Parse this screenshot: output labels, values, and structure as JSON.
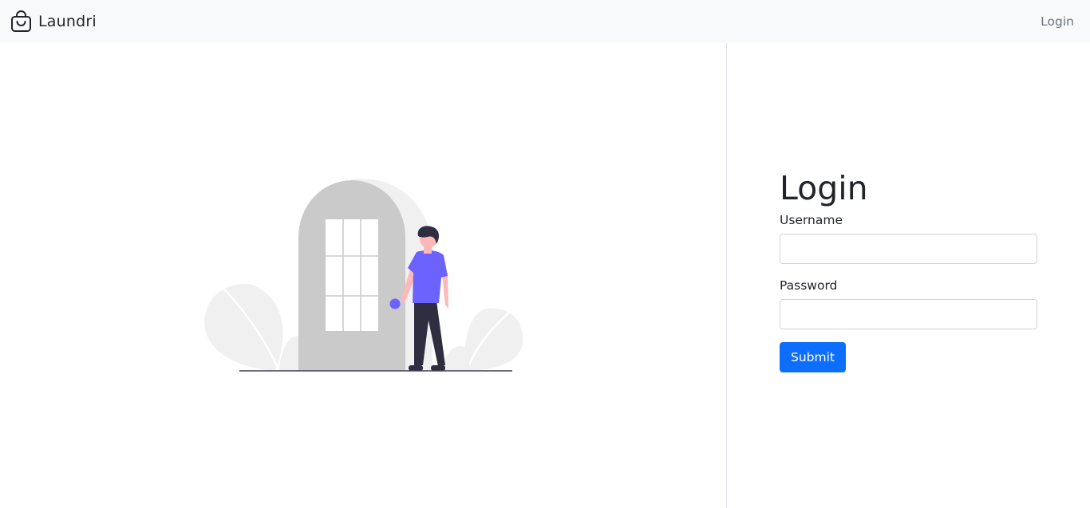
{
  "navbar": {
    "brand_name": "Laundri",
    "brand_icon": "shopping-bag-icon",
    "login_link": "Login"
  },
  "login": {
    "title": "Login",
    "username_label": "Username",
    "username_value": "",
    "password_label": "Password",
    "password_value": "",
    "submit_label": "Submit"
  },
  "illustration": {
    "name": "person-at-door-illustration"
  },
  "colors": {
    "primary": "#0d6efd",
    "navbar_bg": "#f8f9fa",
    "accent_figure": "#6c63ff",
    "door": "#cacaca",
    "foliage": "#f0f0f0"
  }
}
